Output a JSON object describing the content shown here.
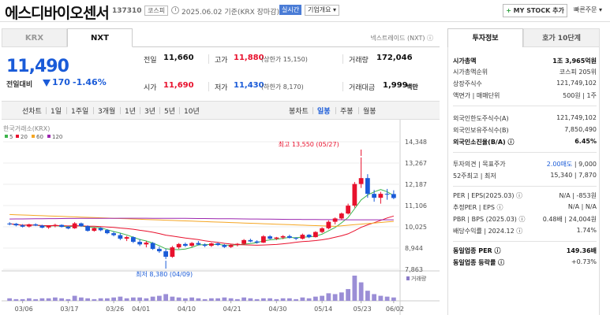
{
  "header": {
    "name": "에스디바이오센서",
    "code": "137310",
    "market": "코스피",
    "base_date": "2025.06.02  기준(KRX 장마감)",
    "realtime": "실시간",
    "company_overview": "기업개요 ▾",
    "mystock_plus": "+",
    "mystock_label": " MY STOCK 추가",
    "quick_order": "빠른주문 ▾"
  },
  "tabs": {
    "krx": "KRX",
    "nxt": "NXT",
    "next_trade": "넥스트레이드 (NXT)  ⓘ"
  },
  "price": {
    "current": "11,490",
    "change_label": "전일대비",
    "change": "170",
    "change_pct": "-1.46%"
  },
  "quote": {
    "prev_label": "전일",
    "prev": "11,660",
    "high_label": "고가",
    "high": "11,880",
    "high_limit": "(상한가 15,150)",
    "volume_label": "거래량",
    "volume": "172,046",
    "open_label": "시가",
    "open": "11,690",
    "low_label": "저가",
    "low": "11,430",
    "low_limit": "(하한가 8,170)",
    "amount_label": "거래대금",
    "amount": "1,999",
    "amount_unit": "백만"
  },
  "periods": {
    "line": "선차트",
    "d1": "1일",
    "w1": "1주일",
    "m3": "3개월",
    "y1": "1년",
    "y3": "3년",
    "y5": "5년",
    "y10": "10년",
    "candle": "봉차트",
    "daily": "일봉",
    "weekly": "주봉",
    "monthly": "월봉"
  },
  "chart_data": {
    "type": "candlestick",
    "source_label": "한국거래소(KRX)",
    "ma_legend": [
      "5",
      "20",
      "60",
      "120"
    ],
    "ma_colors": [
      "#3cb44b",
      "#e8112d",
      "#f5a623",
      "#9c27b0"
    ],
    "y_ticks": [
      "14,348",
      "13,267",
      "12,187",
      "11,106",
      "10,025",
      "8,944",
      "7,863"
    ],
    "ylim": [
      7863,
      14348
    ],
    "x_ticks": [
      "03/06",
      "03/17",
      "03/26",
      "04/01",
      "04/10",
      "04/21",
      "04/30",
      "05/14",
      "05/23",
      "06/02"
    ],
    "volume_label": "거래량",
    "high_annotation": "최고 13,550 (05/27)",
    "low_annotation": "최저 8,380 (04/09)",
    "candles": [
      [
        10190,
        10260,
        10100,
        10180
      ],
      [
        10180,
        10220,
        10050,
        10100
      ],
      [
        10100,
        10160,
        9990,
        10030
      ],
      [
        10040,
        10180,
        9990,
        10150
      ],
      [
        10150,
        10200,
        10060,
        10090
      ],
      [
        10090,
        10130,
        9950,
        9980
      ],
      [
        9990,
        10100,
        9920,
        10060
      ],
      [
        10060,
        10180,
        10000,
        10120
      ],
      [
        10120,
        10150,
        9990,
        10020
      ],
      [
        10020,
        10070,
        9900,
        9940
      ],
      [
        9950,
        10260,
        9920,
        10200
      ],
      [
        10200,
        10240,
        10020,
        10060
      ],
      [
        10060,
        10100,
        9780,
        9820
      ],
      [
        9820,
        10000,
        9780,
        9960
      ],
      [
        9960,
        10000,
        9800,
        9850
      ],
      [
        9860,
        9900,
        9650,
        9700
      ],
      [
        9700,
        9780,
        9540,
        9600
      ],
      [
        9600,
        9700,
        9350,
        9420
      ],
      [
        9420,
        9560,
        9300,
        9500
      ],
      [
        9500,
        9540,
        9200,
        9260
      ],
      [
        9260,
        9400,
        9050,
        9130
      ],
      [
        9130,
        9300,
        8980,
        9220
      ],
      [
        9200,
        9250,
        8850,
        8900
      ],
      [
        8900,
        9010,
        8700,
        8780
      ],
      [
        8780,
        8900,
        8380,
        8500
      ],
      [
        8500,
        9050,
        8450,
        8980
      ],
      [
        8980,
        9200,
        8900,
        9150
      ],
      [
        9150,
        9220,
        9000,
        9060
      ],
      [
        9060,
        9250,
        9000,
        9200
      ],
      [
        9200,
        9300,
        9080,
        9120
      ],
      [
        9120,
        9180,
        8990,
        9060
      ],
      [
        9060,
        9220,
        9000,
        9180
      ],
      [
        9180,
        9230,
        9050,
        9100
      ],
      [
        9100,
        9150,
        8950,
        9000
      ],
      [
        9000,
        9150,
        8950,
        9100
      ],
      [
        9100,
        9200,
        9030,
        9160
      ],
      [
        9160,
        9400,
        9120,
        9350
      ],
      [
        9350,
        9420,
        9240,
        9280
      ],
      [
        9280,
        9340,
        9170,
        9220
      ],
      [
        9220,
        9600,
        9200,
        9540
      ],
      [
        9540,
        9600,
        9380,
        9420
      ],
      [
        9420,
        9510,
        9350,
        9480
      ],
      [
        9480,
        9600,
        9400,
        9550
      ],
      [
        9550,
        9620,
        9430,
        9460
      ],
      [
        9460,
        9500,
        9350,
        9420
      ],
      [
        9420,
        9680,
        9380,
        9620
      ],
      [
        9620,
        9650,
        9450,
        9500
      ],
      [
        9500,
        9800,
        9480,
        9760
      ],
      [
        9760,
        10000,
        9700,
        9950
      ],
      [
        9950,
        10350,
        9900,
        10280
      ],
      [
        10280,
        10500,
        10150,
        10450
      ],
      [
        10450,
        10750,
        10380,
        10700
      ],
      [
        10700,
        11200,
        10650,
        11100
      ],
      [
        11100,
        12300,
        11000,
        12200
      ],
      [
        12200,
        13550,
        12000,
        12500
      ],
      [
        12500,
        12700,
        11500,
        11700
      ],
      [
        11700,
        11900,
        11300,
        11500
      ],
      [
        11500,
        11800,
        11200,
        11700
      ],
      [
        11700,
        11950,
        11400,
        11660
      ],
      [
        11690,
        11880,
        11430,
        11490
      ]
    ],
    "volume": [
      3,
      2,
      2,
      3,
      2,
      3,
      3,
      4,
      3,
      2,
      6,
      4,
      3,
      2,
      3,
      3,
      4,
      5,
      3,
      4,
      4,
      3,
      5,
      6,
      8,
      5,
      4,
      3,
      4,
      3,
      2,
      3,
      3,
      4,
      3,
      2,
      4,
      3,
      2,
      3,
      3,
      2,
      3,
      3,
      2,
      4,
      3,
      5,
      6,
      9,
      8,
      10,
      14,
      30,
      22,
      12,
      8,
      6,
      5,
      4
    ]
  },
  "right_tabs": {
    "info": "투자정보",
    "ask": "호가 10단계"
  },
  "info": {
    "mktcap_label": "시가총액",
    "mktcap": "1조 3,965억원",
    "rank_label": "시가총액순위",
    "rank": "코스피 205위",
    "shares_label": "상장주식수",
    "shares": "121,749,102",
    "par_label": "액면가 | 매매단위",
    "par": "500원 | 1주",
    "foreign_limit_label": "외국인한도주식수(A)",
    "foreign_limit": "121,749,102",
    "foreign_hold_label": "외국인보유주식수(B)",
    "foreign_hold": "7,850,490",
    "foreign_rate_label": "외국인소진율(B/A) ⓘ",
    "foreign_rate": "6.45%",
    "opinion_label": "투자의견 | 목표주가",
    "opinion": "2.00매도",
    "target": " | 9,000",
    "w52_label": "52주최고 | 최저",
    "w52": "15,340 | 7,870",
    "per_label": "PER | EPS(2025.03) ⓘ",
    "per": "N/A | -853원",
    "est_per_label": "추정PER | EPS ⓘ",
    "est_per": "N/A | N/A",
    "pbr_label": "PBR | BPS (2025.03) ⓘ",
    "pbr": "0.48배 | 24,004원",
    "div_label": "배당수익률 | 2024.12 ⓘ",
    "div": "1.74%",
    "ind_per_label": "동일업종 PER ⓘ",
    "ind_per": "149.36배",
    "ind_rate_label": "동일업종 등락률 ⓘ",
    "ind_rate": "+0.73%"
  }
}
